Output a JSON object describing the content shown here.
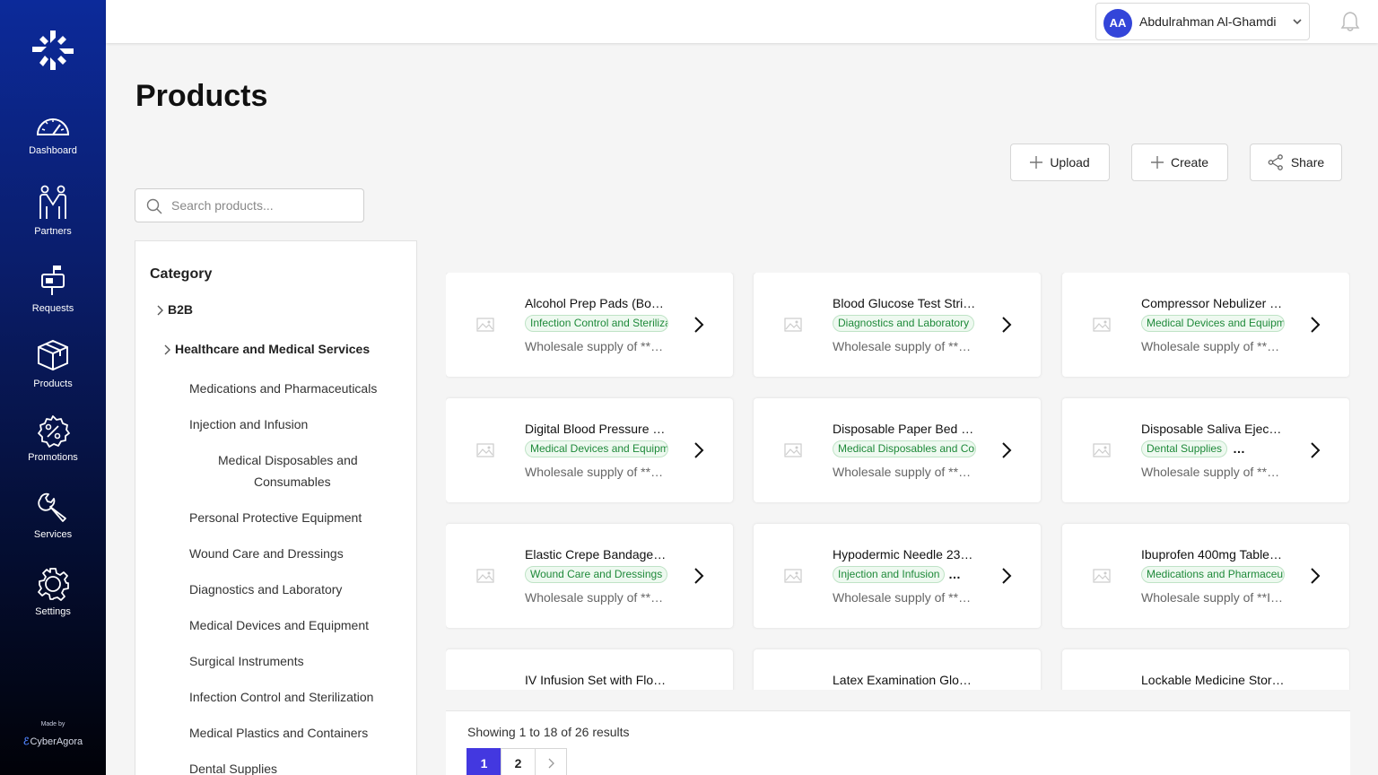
{
  "sidebar": {
    "items": [
      {
        "label": "Dashboard",
        "icon": "dashboard-gauge-icon"
      },
      {
        "label": "Partners",
        "icon": "partners-handshake-icon"
      },
      {
        "label": "Requests",
        "icon": "requests-mailbox-icon"
      },
      {
        "label": "Products",
        "icon": "products-box-icon"
      },
      {
        "label": "Promotions",
        "icon": "promotions-percent-badge-icon"
      },
      {
        "label": "Services",
        "icon": "services-wrench-icon"
      },
      {
        "label": "Settings",
        "icon": "settings-gear-icon"
      }
    ],
    "made_by": "Made by",
    "brand": "CyberAgora"
  },
  "topbar": {
    "user_initials": "AA",
    "user_name": "Abdulrahman Al-Ghamdi"
  },
  "page": {
    "title": "Products",
    "search_placeholder": "Search products...",
    "buttons": {
      "upload": "Upload",
      "create": "Create",
      "share": "Share"
    }
  },
  "categories": {
    "title": "Category",
    "root": "B2B",
    "group": "Healthcare and Medical Services",
    "items": [
      "Medications and Pharmaceuticals",
      "Injection and Infusion",
      "Medical Disposables and",
      "Consumables",
      "Personal Protective Equipment",
      "Wound Care and Dressings",
      "Diagnostics and Laboratory",
      "Medical Devices and Equipment",
      "Surgical Instruments",
      "Infection Control and Sterilization",
      "Medical Plastics and Containers",
      "Dental Supplies"
    ]
  },
  "products": [
    {
      "name": "Alcohol Prep Pads (Bo…",
      "tag": "Infection Control and Sterilization",
      "more": "",
      "desc": "Wholesale supply of **…"
    },
    {
      "name": "Blood Glucose Test Stri…",
      "tag": "Diagnostics and Laboratory",
      "more": "",
      "desc": "Wholesale supply of **…"
    },
    {
      "name": "Compressor Nebulizer …",
      "tag": "Medical Devices and Equipment",
      "more": "",
      "desc": "Wholesale supply of **…"
    },
    {
      "name": "Digital Blood Pressure …",
      "tag": "Medical Devices and Equipment",
      "more": "",
      "desc": "Wholesale supply of **…"
    },
    {
      "name": "Disposable Paper Bed …",
      "tag": "Medical Disposables and Consumables",
      "more": "",
      "desc": "Wholesale supply of **…"
    },
    {
      "name": "Disposable Saliva Ejec…",
      "tag": "Dental Supplies",
      "more": "…",
      "desc": "Wholesale supply of **…"
    },
    {
      "name": "Elastic Crepe Bandage…",
      "tag": "Wound Care and Dressings",
      "more": "",
      "desc": "Wholesale supply of **…"
    },
    {
      "name": "Hypodermic Needle 23…",
      "tag": "Injection and Infusion",
      "more": "…",
      "desc": "Wholesale supply of **…"
    },
    {
      "name": "Ibuprofen 400mg Table…",
      "tag": "Medications and Pharmaceuticals",
      "more": "",
      "desc": "Wholesale supply of **I…"
    },
    {
      "name": "IV Infusion Set with Flo…",
      "tag": "",
      "more": "",
      "desc": ""
    },
    {
      "name": "Latex Examination Glo…",
      "tag": "",
      "more": "",
      "desc": ""
    },
    {
      "name": "Lockable Medicine Stor…",
      "tag": "",
      "more": "",
      "desc": ""
    }
  ],
  "pagination": {
    "showing": "Showing 1 to 18 of 26 results",
    "pages": [
      "1",
      "2"
    ],
    "current": "1"
  },
  "colors": {
    "accent": "#4338e0",
    "avatar": "#3345d9",
    "sidebar_top": "#0c2a9a",
    "tag_text": "#1f8a3a",
    "tag_bg": "#eef9f0"
  }
}
